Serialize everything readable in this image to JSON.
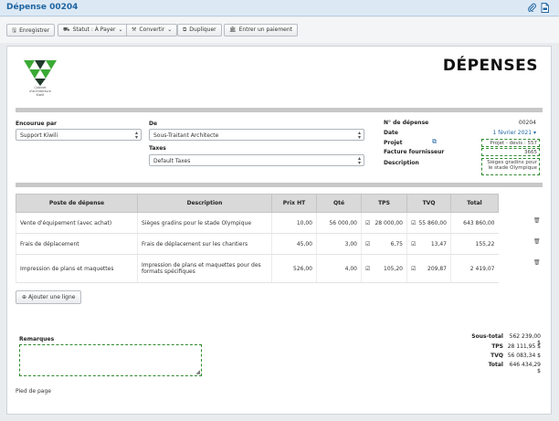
{
  "window": {
    "title": "Dépense 00204"
  },
  "toolbar": {
    "save_label": "Enregistrer",
    "status_label": "Statut : À Payer",
    "convert_label": "Convertir",
    "duplicate_label": "Dupliquer",
    "payment_label": "Entrer un paiement"
  },
  "logo": {
    "line1": "Cabinet",
    "line2": "d'architecture",
    "line3": "Kiwili"
  },
  "doc": {
    "title": "DÉPENSES"
  },
  "form": {
    "encourue_label": "Encourue par",
    "encourue_value": "Support Kiwili",
    "de_label": "De",
    "de_value": "Sous-Traitant Architecte",
    "taxes_label": "Taxes",
    "taxes_value": "Default Taxes"
  },
  "meta": {
    "num_label": "N° de dépense",
    "num_value": "00204",
    "date_label": "Date",
    "date_value": "1 février 2021",
    "projet_label": "Projet",
    "projet_value": "Projet - devis : 557",
    "facture_label": "Facture fournisseur",
    "facture_value": "3665",
    "description_label": "Description",
    "description_value": "Sièges gradins pour le stade Olympique"
  },
  "table": {
    "headers": [
      "Poste de dépense",
      "Description",
      "Prix HT",
      "Qté",
      "TPS",
      "TVQ",
      "Total"
    ],
    "rows": [
      {
        "poste": "Vente d'équipement (avec achat)",
        "description": "Sièges gradins pour le stade Olympique",
        "prix": "10,00",
        "qte": "56 000,00",
        "tps": "28 000,00",
        "tvq": "55 860,00",
        "total": "643 860,00"
      },
      {
        "poste": "Frais de déplacement",
        "description": "Frais de déplacement sur les chantiers",
        "prix": "45,00",
        "qte": "3,00",
        "tps": "6,75",
        "tvq": "13,47",
        "total": "155,22"
      },
      {
        "poste": "Impression de plans et maquettes",
        "description": "Impression de plans et maquettes pour des formats spécifiques",
        "prix": "526,00",
        "qte": "4,00",
        "tps": "105,20",
        "tvq": "209,87",
        "total": "2 419,07"
      }
    ]
  },
  "add_line_label": "Ajouter une ligne",
  "remarks_label": "Remarques",
  "totals": {
    "subtotal_label": "Sous-total",
    "subtotal_value": "562 239,00 $",
    "tps_label": "TPS",
    "tps_value": "28 111,95 $",
    "tvq_label": "TVQ",
    "tvq_value": "56 083,34 $",
    "total_label": "Total",
    "total_value": "646 434,29 $"
  },
  "footer_text": "Pied de page",
  "icons": {
    "save": "save-icon",
    "status": "car-icon",
    "convert": "wand-icon",
    "duplicate": "copy-icon",
    "payment": "bank-icon",
    "attach": "paperclip-icon",
    "pdf": "pdf-icon",
    "external": "external-link-icon",
    "delete": "trash-icon",
    "add": "plus-circle-icon"
  },
  "colors": {
    "title": "#1e64a0",
    "logo_green": "#3aaa35",
    "logo_dark": "#1f3a2a",
    "dashed_border": "#2e8b2e"
  }
}
